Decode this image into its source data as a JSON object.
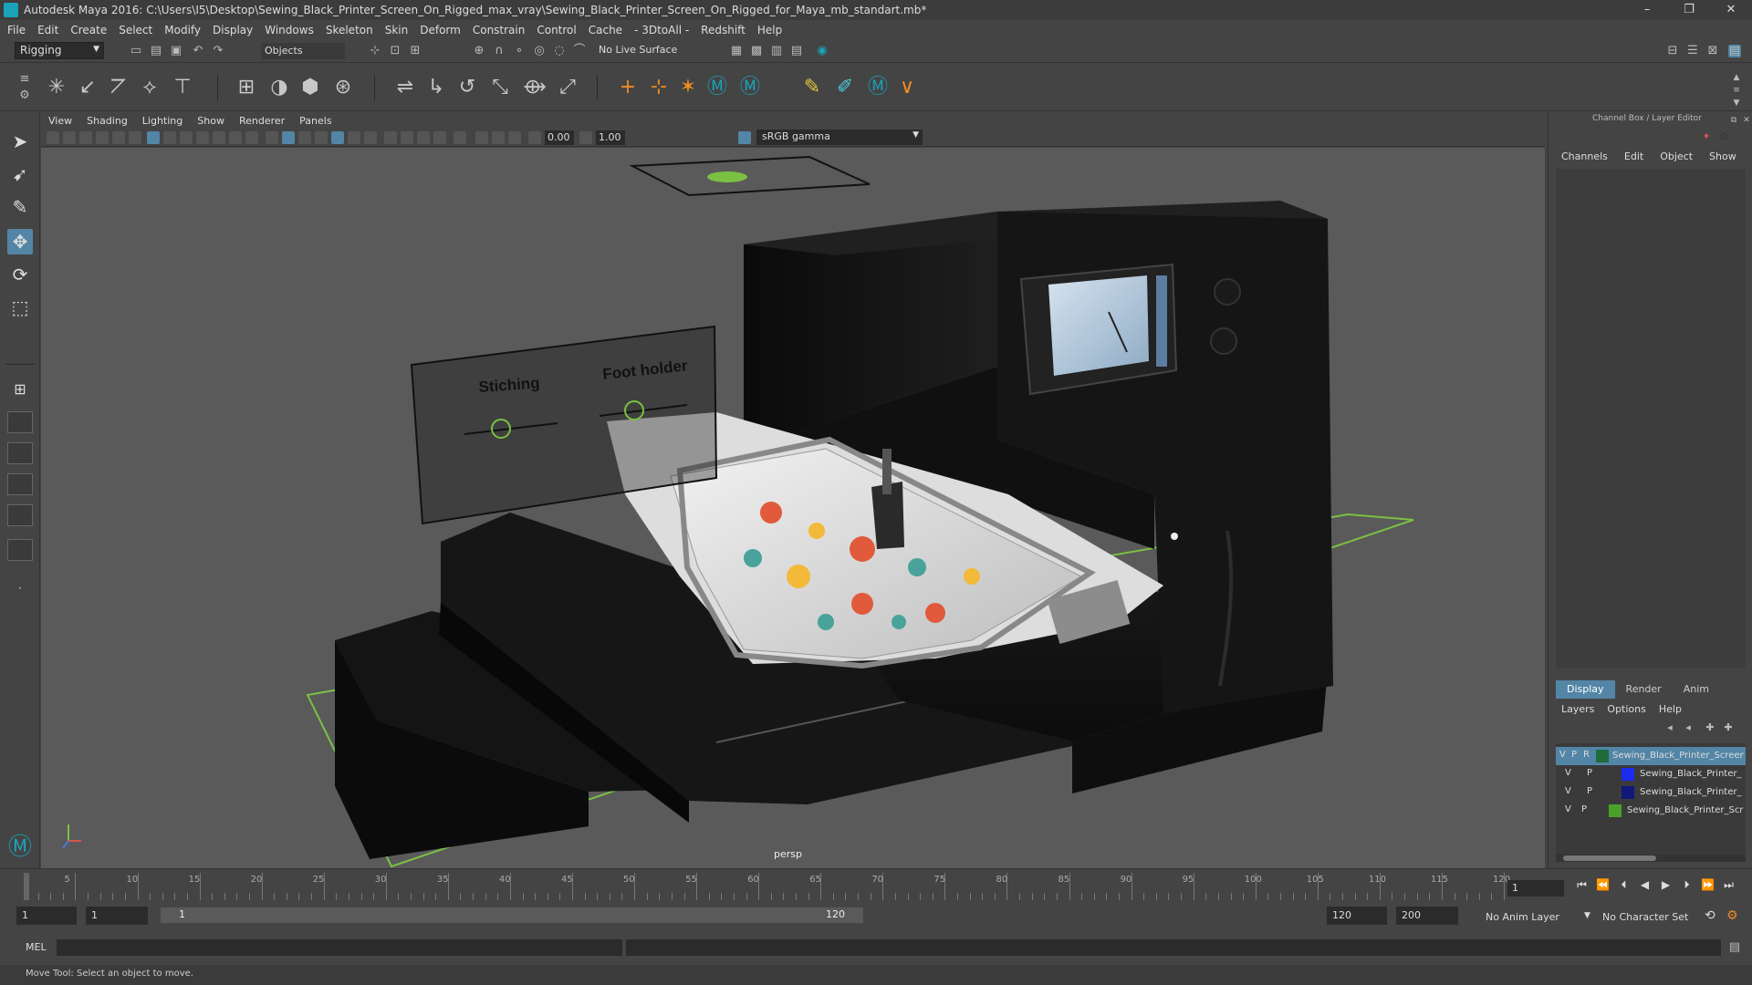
{
  "window": {
    "title": "Autodesk Maya 2016: C:\\Users\\I5\\Desktop\\Sewing_Black_Printer_Screen_On_Rigged_max_vray\\Sewing_Black_Printer_Screen_On_Rigged_for_Maya_mb_standart.mb*",
    "controls": [
      "–",
      "❐",
      "✕"
    ]
  },
  "menubar": [
    "File",
    "Edit",
    "Create",
    "Select",
    "Modify",
    "Display",
    "Windows",
    "Skeleton",
    "Skin",
    "Deform",
    "Constrain",
    "Control",
    "Cache",
    "- 3DtoAll -",
    "Redshift",
    "Help"
  ],
  "status_line": {
    "mode": "Rigging",
    "selection_mask": "Objects",
    "live_surface": "No Live Surface"
  },
  "viewport": {
    "menu": [
      "View",
      "Shading",
      "Lighting",
      "Show",
      "Renderer",
      "Panels"
    ],
    "exposure": "0.00",
    "gamma_value": "1.00",
    "color_space": "sRGB gamma",
    "camera_label": "persp",
    "rig_labels": [
      "Stiching",
      "Foot holder"
    ]
  },
  "channel_box": {
    "title": "Channel Box / Layer Editor",
    "menu": [
      "Channels",
      "Edit",
      "Object",
      "Show"
    ]
  },
  "layer_editor": {
    "tabs": [
      "Display",
      "Render",
      "Anim"
    ],
    "active_tab": "Display",
    "menu": [
      "Layers",
      "Options",
      "Help"
    ],
    "layers": [
      {
        "v": "V",
        "p": "P",
        "r": "R",
        "name": "Sewing_Black_Printer_Screen",
        "color": "#1f6b3c",
        "selected": true
      },
      {
        "v": "V",
        "p": "P",
        "r": "",
        "name": "Sewing_Black_Printer_",
        "color": "#1c2bf0",
        "selected": false
      },
      {
        "v": "V",
        "p": "P",
        "r": "",
        "name": "Sewing_Black_Printer_",
        "color": "#10187a",
        "selected": false
      },
      {
        "v": "V",
        "p": "P",
        "r": "",
        "name": "Sewing_Black_Printer_Scr",
        "color": "#4aa12a",
        "selected": false
      }
    ]
  },
  "timeline": {
    "tick_labels": [
      "5",
      "10",
      "15",
      "20",
      "25",
      "30",
      "35",
      "40",
      "45",
      "50",
      "55",
      "60",
      "65",
      "70",
      "75",
      "80",
      "85",
      "90",
      "95",
      "100",
      "105",
      "110",
      "115",
      "120"
    ],
    "first": "1",
    "current_frame": "1"
  },
  "range": {
    "start": "1",
    "playback_start": "1",
    "slider_start": "1",
    "slider_end": "120",
    "playback_end": "120",
    "end": "200",
    "anim_layer": "No Anim Layer",
    "character_set": "No Character Set"
  },
  "command_line": {
    "label": "MEL"
  },
  "help_line": "Move Tool: Select an object to move."
}
